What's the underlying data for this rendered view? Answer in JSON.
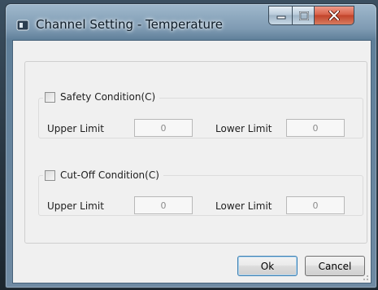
{
  "window": {
    "title": "Channel Setting - Temperature"
  },
  "caption_buttons": {
    "minimize_icon": "minimize-icon",
    "maximize_icon": "maximize-icon",
    "close_icon": "close-icon"
  },
  "safety": {
    "legend": "Safety Condition(C)",
    "checked": false,
    "upper_label": "Upper Limit",
    "upper_value": "0",
    "lower_label": "Lower Limit",
    "lower_value": "0"
  },
  "cutoff": {
    "legend": "Cut-Off Condition(C)",
    "checked": false,
    "upper_label": "Upper Limit",
    "upper_value": "0",
    "lower_label": "Lower Limit",
    "lower_value": "0"
  },
  "buttons": {
    "ok": "Ok",
    "cancel": "Cancel"
  },
  "colors": {
    "close_button": "#c2432a",
    "window_frame": "#7f9bb3",
    "client_bg": "#f0f0f0"
  }
}
